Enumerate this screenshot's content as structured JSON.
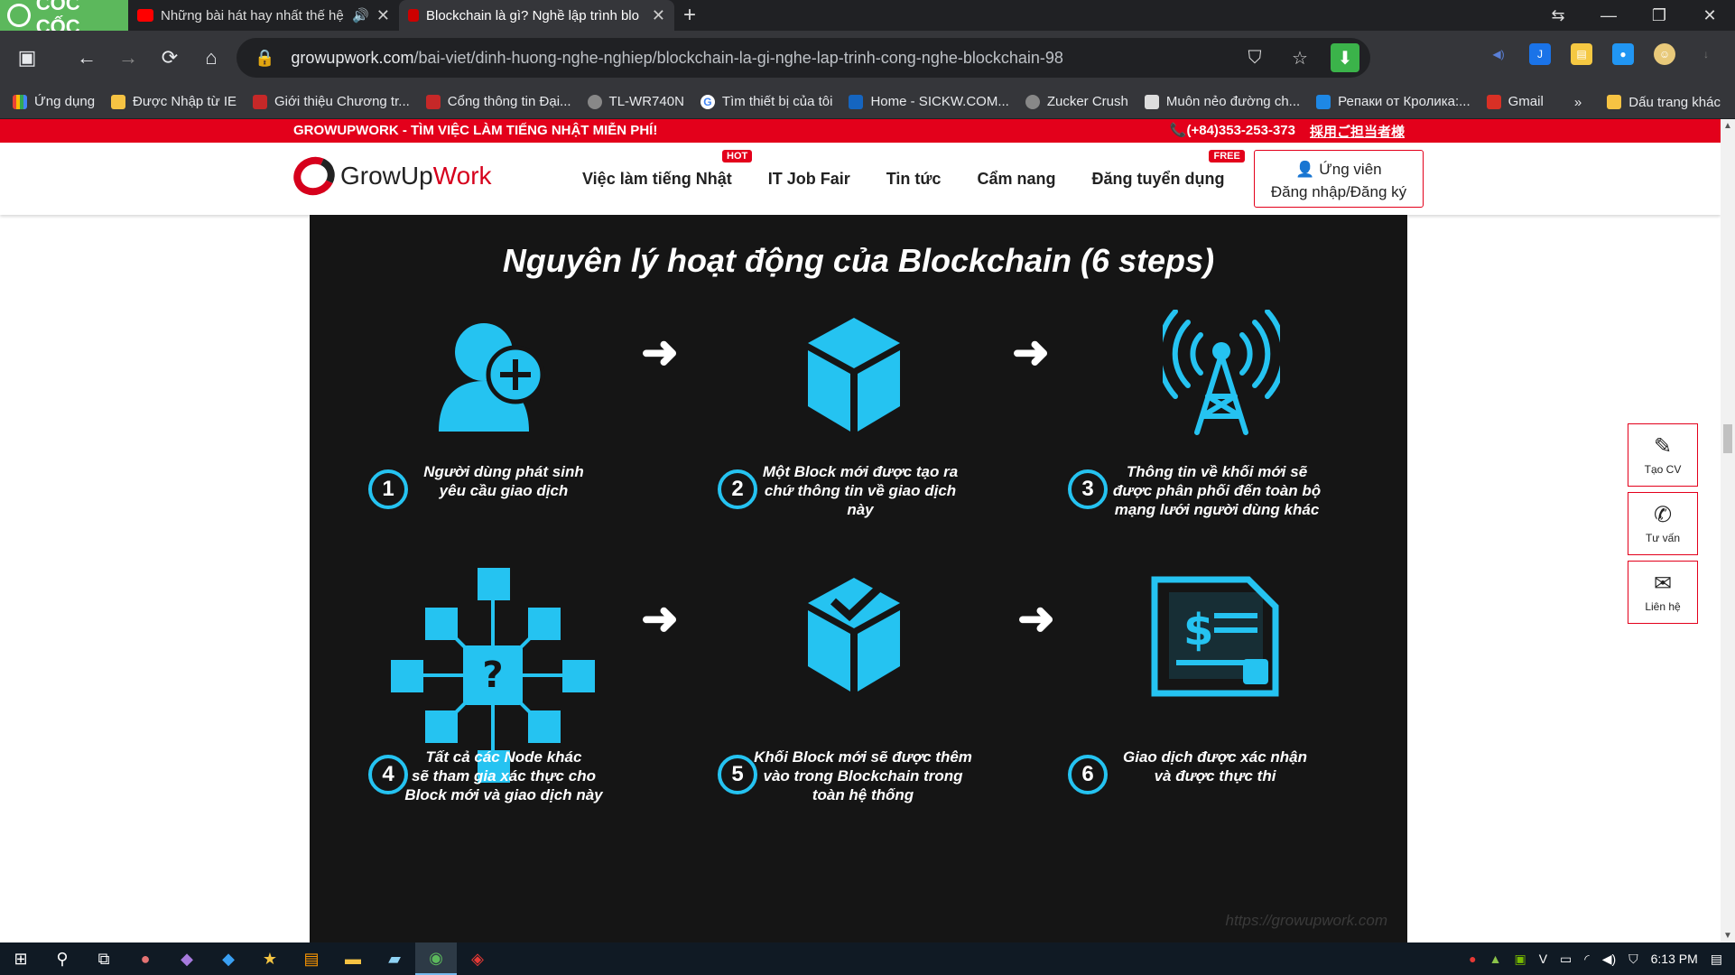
{
  "browser": {
    "brand": "CỐC CỐC",
    "tabs": [
      {
        "title": "Những bài hát hay nhất thế hệ",
        "active": false
      },
      {
        "title": "Blockchain là gì? Nghề lập trình blo",
        "active": true
      }
    ],
    "url_host": "growupwork.com",
    "url_path": "/bai-viet/dinh-huong-nghe-nghiep/blockchain-la-gi-nghe-lap-trinh-cong-nghe-blockchain-98",
    "bookmarks": [
      "Ứng dụng",
      "Được Nhập từ IE",
      "Giới thiệu Chương tr...",
      "Cổng thông tin Đại...",
      "TL-WR740N",
      "Tìm thiết bị của tôi",
      "Home - SICKW.COM...",
      "Zucker Crush",
      "Muôn nẻo đường ch...",
      "Репаки от Кролика:...",
      "Gmail"
    ],
    "bookmarks_more": "»",
    "bookmarks_other": "Dấu trang khác"
  },
  "site": {
    "topbar_left": "GROWUPWORK - TÌM VIỆC LÀM TIẾNG NHẬT MIỄN PHÍ!",
    "phone": "(+84)353-253-373",
    "jp_link": "採用ご担当者様",
    "logo_grow": "Grow",
    "logo_up": "Up",
    "logo_work": "Work",
    "menu": [
      {
        "label": "Việc làm tiếng Nhật",
        "badge": "HOT"
      },
      {
        "label": "IT Job Fair",
        "badge": ""
      },
      {
        "label": "Tin tức",
        "badge": ""
      },
      {
        "label": "Cẩm nang",
        "badge": ""
      },
      {
        "label": "Đăng tuyển dụng",
        "badge": "FREE"
      }
    ],
    "login_line1": "Ứng viên",
    "login_line2": "Đăng nhập/Đăng ký",
    "float_buttons": [
      "Tạo CV",
      "Tư vấn",
      "Liên hệ"
    ]
  },
  "infographic": {
    "title": "Nguyên lý hoạt động của Blockchain (6 steps)",
    "steps": [
      {
        "num": "1",
        "caption": "Người dùng phát sinh\nyêu cầu giao dịch"
      },
      {
        "num": "2",
        "caption": "Một Block mới được tạo ra\nchứ thông tin về giao dịch này"
      },
      {
        "num": "3",
        "caption": "Thông tin về khối mới sẽ\nđược phân phối đến toàn bộ\nmạng lưới người dùng khác"
      },
      {
        "num": "4",
        "caption": "Tất cả các Node khác\nsẽ tham gia xác thực cho\nBlock mới và giao dịch này"
      },
      {
        "num": "5",
        "caption": "Khối Block mới sẽ được thêm\nvào trong Blockchain trong\ntoàn hệ thống"
      },
      {
        "num": "6",
        "caption": "Giao dịch được xác nhận\nvà được thực thi"
      }
    ],
    "watermark": "https://growupwork.com",
    "accent": "#25c3f1"
  },
  "taskbar": {
    "time": "6:13 PM"
  }
}
